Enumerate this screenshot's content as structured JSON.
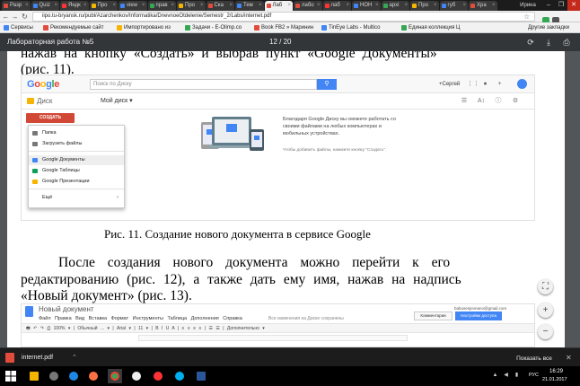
{
  "browser": {
    "tabs": [
      {
        "label": "Разр",
        "favicon_color": "#e34c3c"
      },
      {
        "label": "Quiz",
        "favicon_color": "#4285f4"
      },
      {
        "label": "Яндк",
        "favicon_color": "#ff3333"
      },
      {
        "label": "Про",
        "favicon_color": "#f4b400"
      },
      {
        "label": "view",
        "favicon_color": "#4285f4"
      },
      {
        "label": "прав",
        "favicon_color": "#34a853"
      },
      {
        "label": "Про",
        "favicon_color": "#f4b400"
      },
      {
        "label": "Ска",
        "favicon_color": "#e34c3c"
      },
      {
        "label": "Тем",
        "favicon_color": "#4285f4"
      },
      {
        "label": "Лаб",
        "favicon_color": "#e34c3c"
      },
      {
        "label": "лабо",
        "favicon_color": "#e34c3c"
      },
      {
        "label": "лаб",
        "favicon_color": "#ff3333"
      },
      {
        "label": "НОН",
        "favicon_color": "#4285f4"
      },
      {
        "label": "архі",
        "favicon_color": "#34a853"
      },
      {
        "label": "Про",
        "favicon_color": "#f4b400"
      },
      {
        "label": "губ",
        "favicon_color": "#4285f4"
      },
      {
        "label": "Хра",
        "favicon_color": "#e34c3c"
      }
    ],
    "active_tab": 9,
    "user_name": "Ирина",
    "url": "iipo.tu-bryansk.ru/publ/Azarchenkov/Informatika/DnevnoeOtdelenie/Semestr_2/Labs/internet.pdf",
    "bookmarks": [
      {
        "label": "Сервисы",
        "color": "#4285f4"
      },
      {
        "label": "Рекомендуемые сайт",
        "color": "#e34c3c"
      },
      {
        "label": "Импортировано из",
        "color": "#f4b400"
      },
      {
        "label": "Задачи - E-Olimp.co",
        "color": "#34a853"
      },
      {
        "label": "Book FB2 » Маринин",
        "color": "#e34c3c"
      },
      {
        "label": "TinEye Labs - Multico",
        "color": "#4285f4"
      },
      {
        "label": "Единая коллекция Ц",
        "color": "#34a853"
      }
    ],
    "other_bookmarks": "Другие закладки"
  },
  "pdf": {
    "title": "Лабораторная работа №5",
    "page_current": "12",
    "page_total": "20",
    "page_separator": "/",
    "para1_line1": "нажав на кнопку «Создать» и выбрав пункт «Google Документы»",
    "para1_line2": "(рис. 11).",
    "caption": "Рис. 11. Создание нового документа в сервисе Google",
    "para2_line1": "После создания нового документа можно перейти к его",
    "para2_line2": "редактированию (рис. 12), а также дать ему имя, нажав на надпись",
    "para2_line3": "«Новый документ» (рис. 13)."
  },
  "drive": {
    "logo_letters": [
      {
        "ch": "G",
        "color": "#4285f4"
      },
      {
        "ch": "o",
        "color": "#ea4335"
      },
      {
        "ch": "o",
        "color": "#fbbc05"
      },
      {
        "ch": "g",
        "color": "#4285f4"
      },
      {
        "ch": "l",
        "color": "#34a853"
      },
      {
        "ch": "e",
        "color": "#ea4335"
      }
    ],
    "search_placeholder": "Поиск по Диску",
    "user": "+Сергей",
    "section": "Диск",
    "my_drive": "Мой диск ▾",
    "create_label": "СОЗДАТЬ",
    "menu": [
      {
        "label": "Папка",
        "icon_color": "#777777",
        "highlight": false
      },
      {
        "label": "Загрузить файлы",
        "icon_color": "#777777",
        "highlight": false
      },
      {
        "label": "Google Документы",
        "icon_color": "#4285f4",
        "highlight": true
      },
      {
        "label": "Google Таблицы",
        "icon_color": "#0f9d58",
        "highlight": false
      },
      {
        "label": "Google Презентации",
        "icon_color": "#f4b400",
        "highlight": false
      },
      {
        "label": "Ещё",
        "icon_color": "#ffffff",
        "highlight": false
      }
    ],
    "promo_title": "Благодаря Google Диску вы сможете работать со своими файлами на любых компьютерах и мобильных устройствах.",
    "promo_sub": "Чтобы добавить файлы, нажмите кнопку \"Создать\"."
  },
  "docs": {
    "title": "Новый документ",
    "menu": "Файл Правка Вид Вставка Формат Инструменты Таблица Дополнения Справка",
    "saved": "Все изменения на Диске сохранены",
    "email": "babusenjevnano@gmail.com",
    "comments_label": "Комментарии",
    "share_label": "Настройки доступа",
    "toolbar": "🖶 ↶ ↷ ⎙ 100% ▾ | Обычный ... ▾ | Arial ▾ | 11 ▾ | B I U A | ≡ ≡ ≡ ≡ | ☰ ☰ | Дополнительно ▾"
  },
  "taskbar": {
    "download_file": "internet.pdf",
    "show_all": "Показать все",
    "lang": "РУС",
    "time": "16:29",
    "date": "21.01.2017"
  },
  "colors": {
    "chrome_dark": "#323639",
    "create_red": "#d14836",
    "google_blue": "#4285f4"
  }
}
